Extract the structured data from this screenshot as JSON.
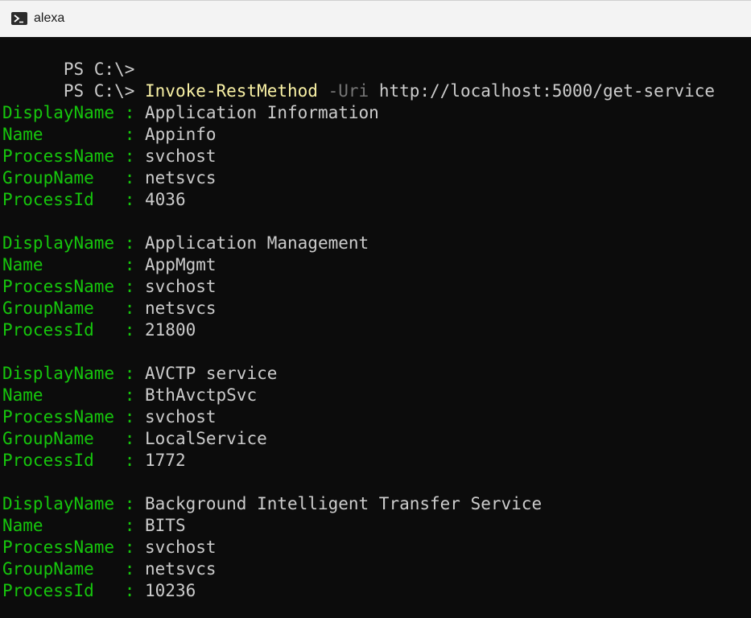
{
  "window": {
    "tab_title": "alexa",
    "icon": "powershell-icon",
    "colors": {
      "background": "#0c0c0c",
      "prompt": "#cccccc",
      "command": "#f9f1a5",
      "parameter": "#767676",
      "property_name": "#16c60c",
      "property_value": "#cccccc"
    }
  },
  "terminal": {
    "prompt_1": "PS C:\\>",
    "prompt_2": "PS C:\\> ",
    "command": "Invoke-RestMethod",
    "parameter": " -Uri",
    "argument": " http://localhost:5000/get-service",
    "records": [
      {
        "display_name_key": "DisplayName : ",
        "display_name": "Application Information",
        "name_key": "Name        : ",
        "name": "Appinfo",
        "process_name_key": "ProcessName : ",
        "process_name": "svchost",
        "group_name_key": "GroupName   : ",
        "group_name": "netsvcs",
        "process_id_key": "ProcessId   : ",
        "process_id": "4036"
      },
      {
        "display_name_key": "DisplayName : ",
        "display_name": "Application Management",
        "name_key": "Name        : ",
        "name": "AppMgmt",
        "process_name_key": "ProcessName : ",
        "process_name": "svchost",
        "group_name_key": "GroupName   : ",
        "group_name": "netsvcs",
        "process_id_key": "ProcessId   : ",
        "process_id": "21800"
      },
      {
        "display_name_key": "DisplayName : ",
        "display_name": "AVCTP service",
        "name_key": "Name        : ",
        "name": "BthAvctpSvc",
        "process_name_key": "ProcessName : ",
        "process_name": "svchost",
        "group_name_key": "GroupName   : ",
        "group_name": "LocalService",
        "process_id_key": "ProcessId   : ",
        "process_id": "1772"
      },
      {
        "display_name_key": "DisplayName : ",
        "display_name": "Background Intelligent Transfer Service",
        "name_key": "Name        : ",
        "name": "BITS",
        "process_name_key": "ProcessName : ",
        "process_name": "svchost",
        "group_name_key": "GroupName   : ",
        "group_name": "netsvcs",
        "process_id_key": "ProcessId   : ",
        "process_id": "10236"
      }
    ]
  }
}
